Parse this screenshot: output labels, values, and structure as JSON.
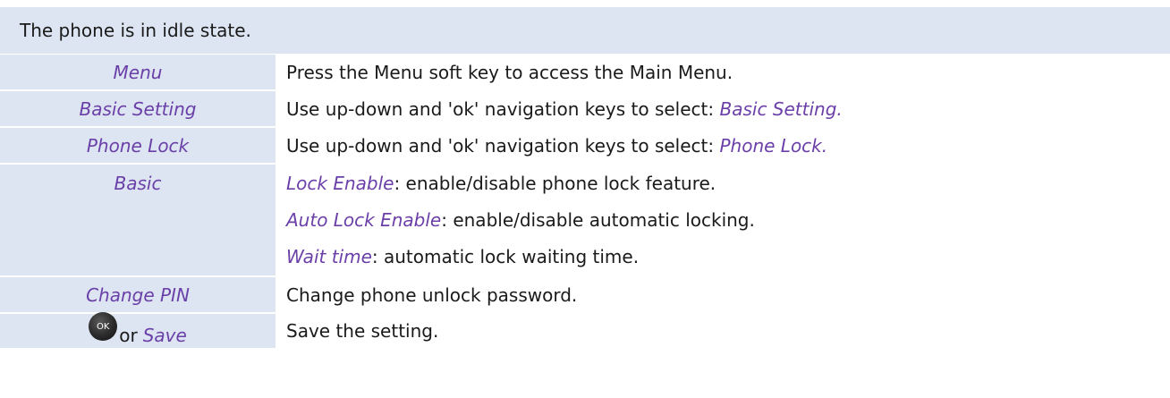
{
  "header": {
    "text": "The phone is in idle state."
  },
  "rows": [
    {
      "step": "Menu",
      "desc": "Press the Menu soft key to access the Main Menu."
    },
    {
      "step": "Basic Setting",
      "desc": "Use up-down and 'ok' navigation keys to select: ",
      "desc_em": "Basic Setting."
    },
    {
      "step": "Phone Lock",
      "desc": "Use up-down and 'ok' navigation keys to select: ",
      "desc_em": "Phone Lock."
    },
    {
      "step": "Basic",
      "lines": [
        {
          "em": "Lock Enable",
          "text": ": enable/disable phone lock feature."
        },
        {
          "em": "Auto Lock Enable",
          "text": ": enable/disable automatic locking."
        },
        {
          "em": "Wait time",
          "text": ": automatic lock waiting time."
        }
      ]
    },
    {
      "step": "Change PIN",
      "desc": "Change phone unlock password."
    },
    {
      "key_icon": "ok-button-icon",
      "key_label": "OK",
      "or": "or",
      "step": "Save",
      "desc": "Save the setting."
    }
  ],
  "colors": {
    "header_bg": "#dce5f1",
    "accent": "#6b3fa8"
  }
}
